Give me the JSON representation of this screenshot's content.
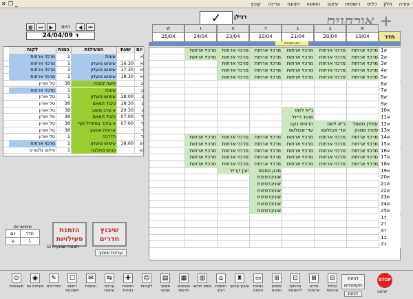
{
  "menu": [
    "עזרה",
    "חלון",
    "כלים",
    "רשומות",
    "עיצוב",
    "הוספה",
    "תצוגה",
    "עריכה",
    "קובץ"
  ],
  "title": "אורחנית +",
  "ragil": "רגילן",
  "nav": {
    "today": "היום",
    "date": "ד 24/04/09"
  },
  "days": [
    {
      "letter": "א",
      "date": "19/04"
    },
    {
      "letter": "ב",
      "date": "20/04"
    },
    {
      "letter": "ג",
      "date": "21/04"
    },
    {
      "letter": "ד",
      "date": "22/04"
    },
    {
      "letter": "ה",
      "date": "23/04"
    },
    {
      "letter": "ו",
      "date": "24/04"
    },
    {
      "letter": "ש",
      "date": "25/04"
    }
  ],
  "room_header": "חדר",
  "yellow_tag": "יום השואה",
  "rooms": [
    "1א",
    "2א",
    "3א",
    "4א",
    "5א",
    "6א",
    "7א",
    "8א",
    "9א",
    "10א",
    "11א",
    "12א",
    "13א",
    "14א",
    "15א",
    "16א",
    "17א",
    "18א",
    "19א",
    "20ש",
    "21ש",
    "22ש",
    "23ש",
    "24ש",
    "25ש",
    "1ד",
    "2ד",
    "3ד",
    "1ב",
    "2ב"
  ],
  "left_list": {
    "headers": [
      "יום",
      "שעת",
      "הפעילות",
      "כמות",
      "לקוח"
    ],
    "rows": [
      [
        "א",
        "",
        "שונות",
        "1",
        "מרכזי ארחות"
      ],
      [
        "א",
        "16:30",
        "שימוש מועדון",
        "1",
        "מרכזי ארחות"
      ],
      [
        "א",
        "17:30",
        "שימוש מועדון",
        "3",
        "מרכזי ארחות"
      ],
      [
        "א",
        "18:30",
        "שימוש מועדון",
        "1",
        "מרכזי ארחות"
      ],
      [
        "ב",
        "",
        "פיצה קטנה",
        "38",
        "טל אורון"
      ],
      [
        "ב",
        "",
        "שונות",
        "1",
        "מרכזי ארחות"
      ],
      [
        "ג",
        "18:00",
        "שימוש מועדון",
        "1",
        "טל אורון"
      ],
      [
        "ג",
        "18:30",
        "כיבוד חמאם",
        "38",
        "טל אורון"
      ],
      [
        "ג",
        "20:30",
        "א.ערב משוב",
        "38",
        "טל אורון"
      ],
      [
        "ד",
        "07:00",
        "כיבוד חמאם",
        "38",
        "טל אורון"
      ],
      [
        "ד",
        "07:00",
        "א.בוקר במתחל סוף",
        "38",
        "טל אורון"
      ],
      [
        "ד",
        "",
        "ארוחת אמצע",
        "38",
        "טל אורון"
      ],
      [
        "ד",
        "",
        "הדרכה",
        "1",
        "טל אורון"
      ],
      [
        "ש",
        "18:00",
        "שימוש מועדון",
        "1",
        "מרכזי ארחות"
      ],
      [
        "ש",
        "",
        "כבוש מחלבה",
        "1",
        "פילוס גלפורס"
      ]
    ]
  },
  "summary": {
    "title": "שימוש יום",
    "col1": "יום",
    "col2": "חדר",
    "row1": [
      "א",
      "1"
    ],
    "row2": [
      "ש",
      "0"
    ]
  },
  "buttons": {
    "rooms": "שיבוץ חדרים",
    "activities": "הזמנת פעילויות",
    "edit_schedule": "עריכת שיבוץ",
    "show_weekly": "תצוגה שבועית",
    "reports_periodic": "דוחות תקופתיים",
    "reports_small": "דוחות",
    "stop": "STOP",
    "exit": "יציאה"
  },
  "toolbar": [
    "חשבוניות",
    "פעילות ושי",
    "מחירונים",
    "רישום חשבונות",
    "הזמנות",
    "עריכת יציאות",
    "הזמנות כמויות",
    "לקוחות",
    "מסמך שבועי",
    "שיבוצים חדשים",
    "טופס חודשי",
    "הזמנות רוחב",
    "שיבוץ שבועי",
    "כמויות הזמנה",
    "שימוש נתונים",
    "ארוחות להזמנות",
    "פירוט ארוחות",
    "טבלת ארוחות"
  ],
  "cells": [
    {
      "r": 0,
      "cols": [
        0,
        1,
        2,
        3,
        4,
        5
      ],
      "text": "מרכזי ארחות"
    },
    {
      "r": 1,
      "cols": [
        0,
        1,
        2,
        3,
        4,
        5
      ],
      "text": "מרכזי ארחות"
    },
    {
      "r": 2,
      "cols": [
        0,
        1,
        2,
        3,
        4
      ],
      "text": "מרכזי ארחות"
    },
    {
      "r": 3,
      "cols": [
        0,
        1,
        2,
        3,
        4
      ],
      "text": "מרכזי ארחות"
    },
    {
      "r": 4,
      "cols": [
        0,
        1,
        2,
        3,
        4
      ],
      "text": "מרכזי ארחות"
    },
    {
      "r": 9,
      "cols": [
        2
      ],
      "text": "ג'יא לשט"
    },
    {
      "r": 10,
      "cols": [
        2
      ],
      "text": "אהוד רייזל"
    },
    {
      "r": 11,
      "cols": [
        0
      ],
      "text": "עמידן חשמל"
    },
    {
      "r": 11,
      "cols": [
        1
      ],
      "text": "ג'יא לשט"
    },
    {
      "r": 11,
      "cols": [
        2
      ],
      "text": "הדסית נקט"
    },
    {
      "r": 12,
      "cols": [
        0
      ],
      "text": "פטרו סמנק"
    },
    {
      "r": 12,
      "cols": [
        1
      ],
      "text": "עדי אבולעפ"
    },
    {
      "r": 12,
      "cols": [
        2
      ],
      "text": "עדי אבולעפ"
    },
    {
      "r": 13,
      "cols": [
        0,
        1,
        2,
        3,
        4,
        5
      ],
      "text": "מרכזי ארחות"
    },
    {
      "r": 14,
      "cols": [
        0,
        1,
        2,
        3,
        4,
        5
      ],
      "text": "מרכזי ארחות"
    },
    {
      "r": 15,
      "cols": [
        0,
        1,
        2,
        3,
        4,
        5
      ],
      "text": "מרכזי ארחות"
    },
    {
      "r": 16,
      "cols": [
        0,
        1,
        2,
        3,
        4,
        5
      ],
      "text": "מרכזי ארחות"
    },
    {
      "r": 17,
      "cols": [
        0,
        1,
        2,
        3,
        4,
        5
      ],
      "text": "מרכזי ארחות"
    },
    {
      "r": 18,
      "cols": [
        3
      ],
      "text": "מכון מפסס"
    },
    {
      "r": 18,
      "cols": [
        4
      ],
      "text": "יובן קרייר"
    },
    {
      "r": 19,
      "cols": [
        3
      ],
      "text": "אוניברסיטת"
    },
    {
      "r": 20,
      "cols": [
        3
      ],
      "text": "אוניברסיטת"
    },
    {
      "r": 21,
      "cols": [
        3
      ],
      "text": "אוניברסיטת"
    },
    {
      "r": 22,
      "cols": [
        3
      ],
      "text": "אוניברסיטת"
    },
    {
      "r": 23,
      "cols": [
        3
      ],
      "text": "אוניברסיטת"
    },
    {
      "r": 24,
      "cols": [
        3
      ],
      "text": "אוניברסיטת"
    }
  ]
}
